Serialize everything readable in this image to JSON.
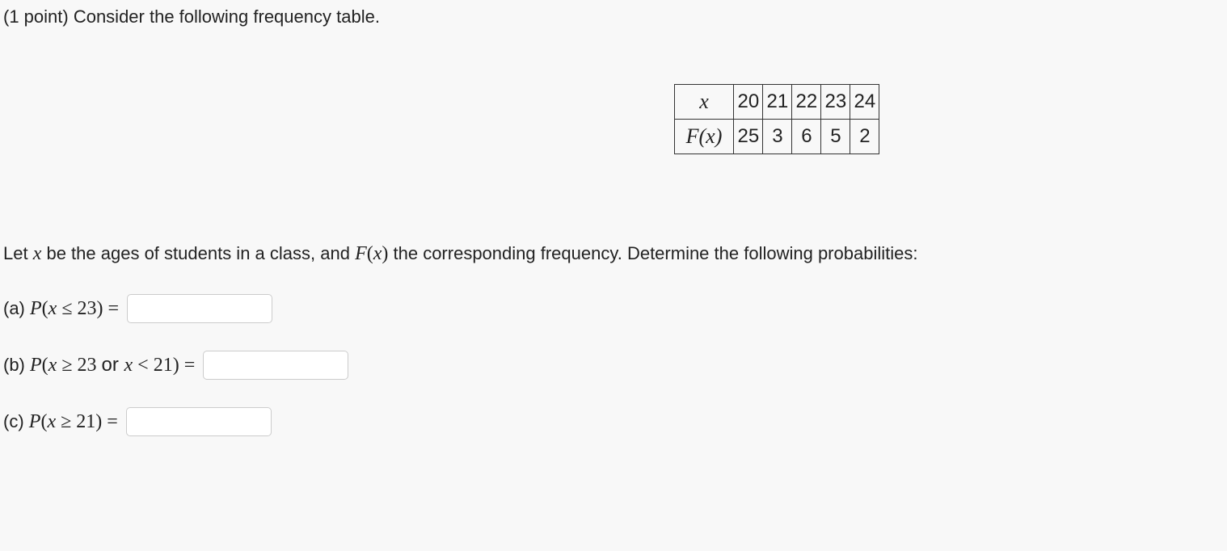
{
  "intro": "(1 point) Consider the following frequency table.",
  "table": {
    "row1_head": "x",
    "row2_head": "F(x)",
    "x_values": [
      "20",
      "21",
      "22",
      "23",
      "24"
    ],
    "f_values": [
      "25",
      "3",
      "6",
      "5",
      "2"
    ]
  },
  "mid_text_prefix": "Let ",
  "mid_text_var": "x",
  "mid_text_middle": " be the ages of students in a class, and ",
  "mid_text_fx": "F(x)",
  "mid_text_suffix": " the corresponding frequency. Determine the following probabilities:",
  "qa": {
    "label": "(a) ",
    "expr_P": "P",
    "expr_open": "(",
    "expr_x": "x",
    "expr_rel": " ≤ 23) =",
    "value": ""
  },
  "qb": {
    "label": "(b) ",
    "expr_P": "P",
    "expr_open": "(",
    "expr_x1": "x",
    "expr_rel1": " ≥ 23 ",
    "expr_or": "or ",
    "expr_x2": "x",
    "expr_rel2": " < 21) =",
    "value": ""
  },
  "qc": {
    "label": "(c) ",
    "expr_P": "P",
    "expr_open": "(",
    "expr_x": "x",
    "expr_rel": " ≥ 21) =",
    "value": ""
  }
}
